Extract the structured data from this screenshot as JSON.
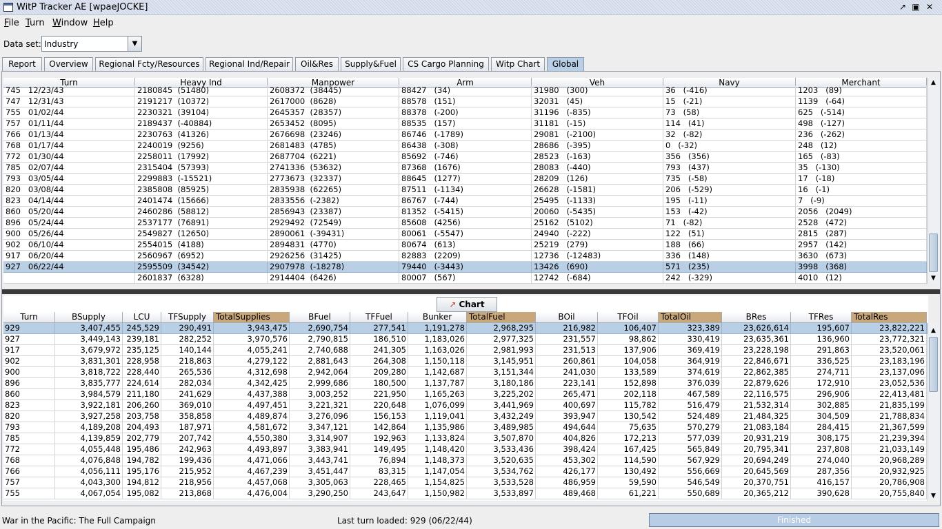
{
  "window": {
    "title": "WitP Tracker AE [wpaeJOCKE]"
  },
  "menu": [
    "File",
    "Turn",
    "Window",
    "Help"
  ],
  "dataset": {
    "label": "Data set:",
    "value": "Industry"
  },
  "tabs": [
    {
      "label": "Report"
    },
    {
      "label": "Overview"
    },
    {
      "label": "Regional Fcty/Resources"
    },
    {
      "label": "Regional Ind/Repair"
    },
    {
      "label": "Oil&Res"
    },
    {
      "label": "Supply&Fuel"
    },
    {
      "label": "CS Cargo Planning"
    },
    {
      "label": "Witp Chart"
    },
    {
      "label": "Global",
      "active": true
    }
  ],
  "upper_table": {
    "columns": [
      "Turn",
      "Heavy Ind",
      "Manpower",
      "Arm",
      "Veh",
      "Navy",
      "Merchant"
    ],
    "rows": [
      {
        "turn": "745   12/23/43",
        "heavy_ind": "2180845  (51480)",
        "manpower": "2608372  (38445)",
        "arm": "88427   (34)",
        "veh": "31980   (300)",
        "navy": "36   (-416)",
        "merchant": "1203   (89)"
      },
      {
        "turn": "747   12/31/43",
        "heavy_ind": "2191217  (10372)",
        "manpower": "2617000  (8628)",
        "arm": "88578   (151)",
        "veh": "32031   (45)",
        "navy": "15   (-21)",
        "merchant": "1139   (-64)"
      },
      {
        "turn": "755   01/02/44",
        "heavy_ind": "2230321  (39104)",
        "manpower": "2645357  (28357)",
        "arm": "88378   (-200)",
        "veh": "31196   (-835)",
        "navy": "73   (58)",
        "merchant": "625   (-514)"
      },
      {
        "turn": "757   01/11/44",
        "heavy_ind": "2189437  (-40884)",
        "manpower": "2653452  (8095)",
        "arm": "88535   (157)",
        "veh": "31181   (-15)",
        "navy": "114   (41)",
        "merchant": "498   (-127)"
      },
      {
        "turn": "766   01/13/44",
        "heavy_ind": "2230763  (41326)",
        "manpower": "2676698  (23246)",
        "arm": "86746   (-1789)",
        "veh": "29081   (-2100)",
        "navy": "32   (-82)",
        "merchant": "236   (-262)"
      },
      {
        "turn": "768   01/17/44",
        "heavy_ind": "2240019  (9256)",
        "manpower": "2681483  (4785)",
        "arm": "86438   (-308)",
        "veh": "28686   (-395)",
        "navy": "0   (-32)",
        "merchant": "248   (12)"
      },
      {
        "turn": "772   01/30/44",
        "heavy_ind": "2258011  (17992)",
        "manpower": "2687704  (6221)",
        "arm": "85692   (-746)",
        "veh": "28523   (-163)",
        "navy": "356   (356)",
        "merchant": "165   (-83)"
      },
      {
        "turn": "785   02/07/44",
        "heavy_ind": "2315404  (57393)",
        "manpower": "2741336  (53632)",
        "arm": "87368   (1676)",
        "veh": "28083   (-440)",
        "navy": "793   (437)",
        "merchant": "35   (-130)"
      },
      {
        "turn": "793   03/05/44",
        "heavy_ind": "2299883  (-15521)",
        "manpower": "2773673  (32337)",
        "arm": "88645   (1277)",
        "veh": "28209   (126)",
        "navy": "735   (-58)",
        "merchant": "17   (-18)"
      },
      {
        "turn": "820   03/08/44",
        "heavy_ind": "2385808  (85925)",
        "manpower": "2835938  (62265)",
        "arm": "87511   (-1134)",
        "veh": "26628   (-1581)",
        "navy": "206   (-529)",
        "merchant": "16   (-1)"
      },
      {
        "turn": "823   04/14/44",
        "heavy_ind": "2401474  (15666)",
        "manpower": "2833556  (-2382)",
        "arm": "86767   (-744)",
        "veh": "25495   (-1133)",
        "navy": "195   (-11)",
        "merchant": "7   (-9)"
      },
      {
        "turn": "860   05/20/44",
        "heavy_ind": "2460286  (58812)",
        "manpower": "2856943  (23387)",
        "arm": "81352   (-5415)",
        "veh": "20060   (-5435)",
        "navy": "153   (-42)",
        "merchant": "2056   (2049)"
      },
      {
        "turn": "896   05/24/44",
        "heavy_ind": "2537177  (76891)",
        "manpower": "2929492  (72549)",
        "arm": "85608   (4256)",
        "veh": "25162   (5102)",
        "navy": "71   (-82)",
        "merchant": "2528   (472)"
      },
      {
        "turn": "900   05/26/44",
        "heavy_ind": "2549827  (12650)",
        "manpower": "2890061  (-39431)",
        "arm": "80061   (-5547)",
        "veh": "24940   (-222)",
        "navy": "122   (51)",
        "merchant": "2815   (287)"
      },
      {
        "turn": "902   06/10/44",
        "heavy_ind": "2554015  (4188)",
        "manpower": "2894831  (4770)",
        "arm": "80674   (613)",
        "veh": "25219   (279)",
        "navy": "188   (66)",
        "merchant": "2957   (142)"
      },
      {
        "turn": "917   06/20/44",
        "heavy_ind": "2560967  (6952)",
        "manpower": "2926256  (31425)",
        "arm": "82883   (2209)",
        "veh": "12736   (-12483)",
        "navy": "336   (148)",
        "merchant": "3630   (673)"
      },
      {
        "turn": "927   06/22/44",
        "heavy_ind": "2595509  (34542)",
        "manpower": "2907978  (-18278)",
        "arm": "79440   (-3443)",
        "veh": "13426   (690)",
        "navy": "571   (235)",
        "merchant": "3998   (368)",
        "selected": true
      },
      {
        "turn": "",
        "heavy_ind": "2601837  (6328)",
        "manpower": "2914404  (6426)",
        "arm": "80007   (567)",
        "veh": "12742   (-684)",
        "navy": "242   (-329)",
        "merchant": "4010   (12)"
      }
    ]
  },
  "lower_panel": {
    "chart_button": "Chart",
    "columns": [
      "Turn",
      "BSupply",
      "LCU",
      "TFSupply",
      "TotalSupplies",
      "BFuel",
      "TFFuel",
      "Bunker",
      "TotalFuel",
      "BOil",
      "TFOil",
      "TotalOil",
      "BRes",
      "TFRes",
      "TotalRes"
    ],
    "rows": [
      {
        "c": [
          "929",
          "3,407,455",
          "245,529",
          "290,491",
          "3,943,475",
          "2,690,754",
          "277,541",
          "1,191,278",
          "2,968,295",
          "216,982",
          "106,407",
          "323,389",
          "23,626,614",
          "195,607",
          "23,822,221"
        ],
        "selected": true
      },
      {
        "c": [
          "927",
          "3,449,143",
          "239,181",
          "282,252",
          "3,970,576",
          "2,790,815",
          "186,510",
          "1,183,026",
          "2,977,325",
          "231,557",
          "98,862",
          "330,419",
          "23,635,361",
          "136,960",
          "23,772,321"
        ]
      },
      {
        "c": [
          "917",
          "3,679,972",
          "235,125",
          "140,144",
          "4,055,241",
          "2,740,688",
          "241,305",
          "1,163,026",
          "2,981,993",
          "231,513",
          "137,906",
          "369,419",
          "23,228,198",
          "291,863",
          "23,520,061"
        ]
      },
      {
        "c": [
          "902",
          "3,831,301",
          "228,958",
          "218,863",
          "4,279,122",
          "2,881,643",
          "264,308",
          "1,150,118",
          "3,145,951",
          "260,861",
          "104,058",
          "364,919",
          "22,846,671",
          "336,525",
          "23,183,196"
        ]
      },
      {
        "c": [
          "900",
          "3,818,722",
          "228,440",
          "265,536",
          "4,312,698",
          "2,942,064",
          "209,280",
          "1,142,687",
          "3,151,344",
          "241,030",
          "133,589",
          "374,619",
          "22,862,385",
          "274,711",
          "23,137,096"
        ]
      },
      {
        "c": [
          "896",
          "3,835,777",
          "224,614",
          "282,034",
          "4,342,425",
          "2,999,686",
          "180,500",
          "1,137,787",
          "3,180,186",
          "223,141",
          "152,898",
          "376,039",
          "22,879,626",
          "172,910",
          "23,052,536"
        ]
      },
      {
        "c": [
          "860",
          "3,984,579",
          "211,180",
          "241,629",
          "4,437,388",
          "3,003,252",
          "221,950",
          "1,165,263",
          "3,225,202",
          "265,471",
          "202,118",
          "467,589",
          "22,116,575",
          "296,906",
          "22,413,481"
        ]
      },
      {
        "c": [
          "823",
          "3,922,181",
          "206,260",
          "369,010",
          "4,497,451",
          "3,221,321",
          "220,648",
          "1,076,099",
          "3,441,969",
          "400,697",
          "115,782",
          "516,479",
          "21,532,314",
          "302,885",
          "21,835,199"
        ]
      },
      {
        "c": [
          "820",
          "3,927,258",
          "203,758",
          "358,858",
          "4,489,874",
          "3,276,096",
          "156,153",
          "1,119,041",
          "3,432,249",
          "393,947",
          "130,542",
          "524,489",
          "21,484,325",
          "304,509",
          "21,788,834"
        ]
      },
      {
        "c": [
          "793",
          "4,189,208",
          "204,493",
          "187,971",
          "4,581,672",
          "3,347,121",
          "142,864",
          "1,135,986",
          "3,489,985",
          "494,644",
          "75,635",
          "570,279",
          "21,083,184",
          "284,415",
          "21,367,599"
        ]
      },
      {
        "c": [
          "785",
          "4,139,859",
          "202,779",
          "207,742",
          "4,550,380",
          "3,314,907",
          "192,963",
          "1,133,824",
          "3,507,870",
          "404,826",
          "172,213",
          "577,039",
          "20,931,219",
          "308,175",
          "21,239,394"
        ]
      },
      {
        "c": [
          "772",
          "4,055,448",
          "195,486",
          "242,963",
          "4,493,897",
          "3,383,941",
          "149,495",
          "1,148,420",
          "3,533,436",
          "398,424",
          "167,425",
          "565,849",
          "20,795,341",
          "237,808",
          "21,033,149"
        ]
      },
      {
        "c": [
          "768",
          "4,076,848",
          "194,782",
          "199,436",
          "4,471,066",
          "3,443,741",
          "76,894",
          "1,148,373",
          "3,520,635",
          "453,302",
          "114,590",
          "567,929",
          "20,694,249",
          "274,040",
          "20,968,289"
        ]
      },
      {
        "c": [
          "766",
          "4,056,111",
          "195,176",
          "215,952",
          "4,467,239",
          "3,451,447",
          "83,315",
          "1,147,054",
          "3,534,762",
          "426,177",
          "130,492",
          "556,669",
          "20,645,569",
          "287,356",
          "20,932,925"
        ]
      },
      {
        "c": [
          "757",
          "4,043,300",
          "194,812",
          "218,956",
          "4,457,068",
          "3,305,063",
          "228,465",
          "1,154,825",
          "3,533,528",
          "486,959",
          "59,590",
          "546,549",
          "20,370,751",
          "416,157",
          "20,786,908"
        ]
      },
      {
        "c": [
          "755",
          "4,067,054",
          "195,082",
          "213,868",
          "4,476,004",
          "3,290,250",
          "243,647",
          "1,150,982",
          "3,533,897",
          "489,468",
          "61,221",
          "550,689",
          "20,365,212",
          "390,628",
          "20,755,840"
        ]
      }
    ]
  },
  "status": {
    "left": "War in the Pacific: The Full Campaign",
    "middle": "Last turn loaded: 929 (06/22/44)",
    "progress_label": "Finished",
    "progress_fraction": 1.0
  },
  "colors": {
    "selection": "#b8cfe5",
    "total_header": "#c8a77a",
    "splitter": "#3a3a3a"
  }
}
